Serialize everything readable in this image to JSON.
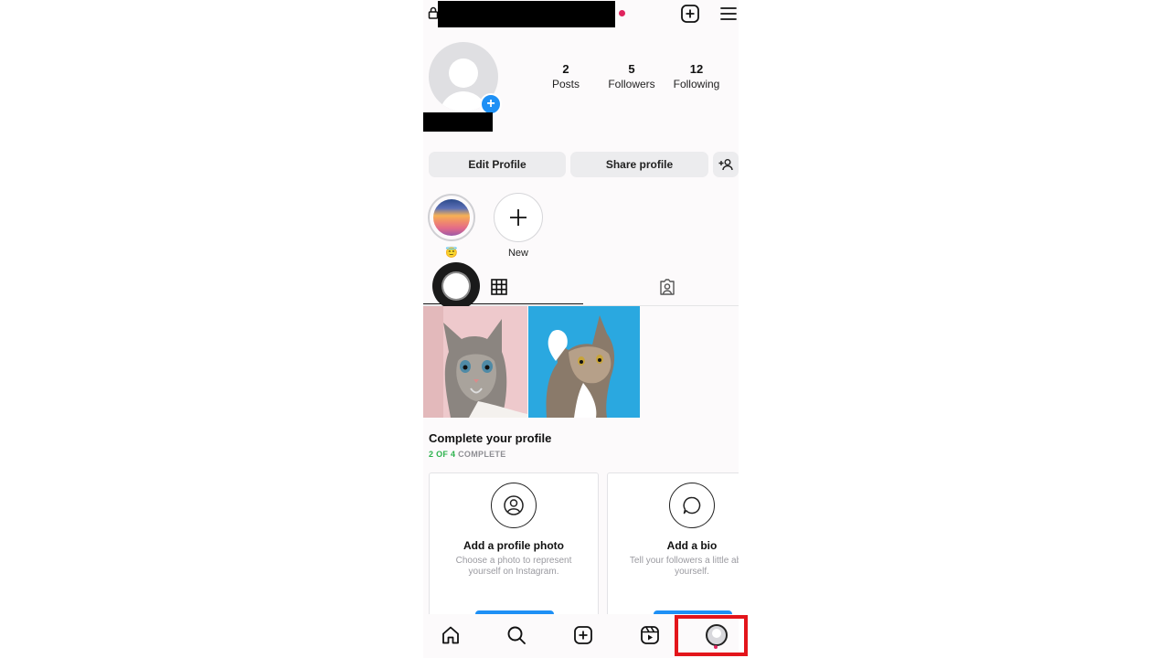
{
  "stats": {
    "posts": {
      "count": "2",
      "label": "Posts"
    },
    "followers": {
      "count": "5",
      "label": "Followers"
    },
    "following": {
      "count": "12",
      "label": "Following"
    }
  },
  "actions": {
    "edit_profile": "Edit Profile",
    "share_profile": "Share profile"
  },
  "highlights": [
    {
      "label": "😇"
    },
    {
      "label": "New"
    }
  ],
  "complete_profile": {
    "title": "Complete your profile",
    "progress_done": "2 OF 4",
    "progress_suffix": " COMPLETE",
    "progress_fraction": 0.5,
    "cards": [
      {
        "title": "Add a profile photo",
        "desc": "Choose a photo to represent yourself on Instagram."
      },
      {
        "title": "Add a bio",
        "desc": "Tell your followers a little about yourself."
      }
    ]
  },
  "bottom_nav": [
    "home-icon",
    "search-icon",
    "create-icon",
    "reels-icon",
    "profile-icon"
  ],
  "colors": {
    "accent": "#1e90f5",
    "notification": "#e0245e",
    "progress_green": "#2bb24c",
    "highlight_box": "#e3151b"
  }
}
